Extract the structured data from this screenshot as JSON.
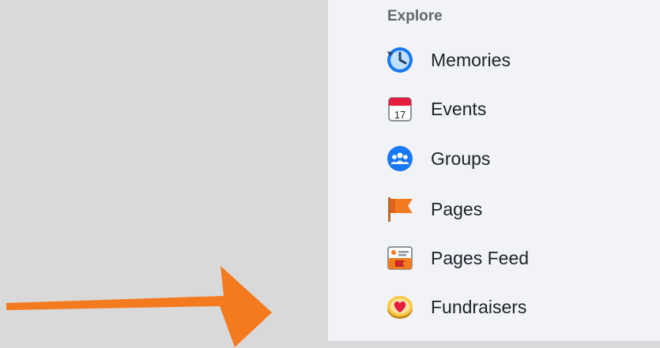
{
  "explore": {
    "title": "Explore",
    "items": [
      {
        "label": "Memories",
        "icon": "memories-clock-icon"
      },
      {
        "label": "Events",
        "icon": "events-calendar-icon",
        "calendar_day": "17"
      },
      {
        "label": "Groups",
        "icon": "groups-icon"
      },
      {
        "label": "Pages",
        "icon": "pages-flag-icon"
      },
      {
        "label": "Pages Feed",
        "icon": "pages-feed-icon"
      },
      {
        "label": "Fundraisers",
        "icon": "fundraisers-heart-icon"
      }
    ]
  },
  "annotation": {
    "icon": "pointer-arrow-icon",
    "color": "#f47a20"
  },
  "colors": {
    "background": "#d9d9d9",
    "panel": "#f2f3f6",
    "heading": "#616770",
    "text": "#1d2129"
  }
}
